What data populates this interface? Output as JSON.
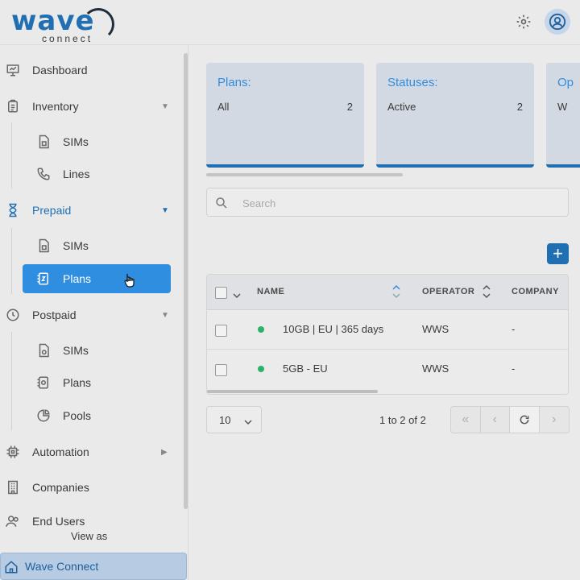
{
  "brand": {
    "logo_text": "wave",
    "logo_sub": "connect"
  },
  "header": {
    "settings_icon": "gear-icon",
    "profile_icon": "user-circle-icon"
  },
  "sidebar": {
    "items": [
      {
        "label": "Dashboard",
        "icon": "presentation-icon"
      },
      {
        "label": "Inventory",
        "icon": "clipboard-icon",
        "caret": "▼"
      },
      {
        "label": "SIMs",
        "icon": "sim-icon"
      },
      {
        "label": "Lines",
        "icon": "phone-icon"
      },
      {
        "label": "Prepaid",
        "icon": "hourglass-icon",
        "caret": "▼"
      },
      {
        "label": "SIMs",
        "icon": "sim-icon"
      },
      {
        "label": "Plans",
        "icon": "plan-icon",
        "active": true
      },
      {
        "label": "Postpaid",
        "icon": "clock-icon",
        "caret": "▼"
      },
      {
        "label": "SIMs",
        "icon": "sim-icon"
      },
      {
        "label": "Plans",
        "icon": "plan-icon"
      },
      {
        "label": "Pools",
        "icon": "pie-icon"
      },
      {
        "label": "Automation",
        "icon": "chip-icon",
        "caret": "▶"
      },
      {
        "label": "Companies",
        "icon": "building-icon"
      },
      {
        "label": "End Users",
        "icon": "users-icon"
      }
    ],
    "view_as": "View as",
    "current_view": "Wave Connect"
  },
  "cards": [
    {
      "title": "Plans:",
      "label": "All",
      "value": "2"
    },
    {
      "title": "Statuses:",
      "label": "Active",
      "value": "2"
    },
    {
      "title": "Op",
      "label": "W",
      "value": ""
    }
  ],
  "search": {
    "placeholder": "Search"
  },
  "add_button": "+",
  "table": {
    "headers": [
      "NAME",
      "OPERATOR",
      "COMPANY"
    ],
    "rows": [
      {
        "name": "10GB | EU | 365 days",
        "operator": "WWS",
        "company": "-",
        "status_color": "#2ab36b"
      },
      {
        "name": "5GB - EU",
        "operator": "WWS",
        "company": "-",
        "status_color": "#2ab36b"
      }
    ]
  },
  "pagination": {
    "page_size": "10",
    "range": "1 to 2 of 2"
  }
}
